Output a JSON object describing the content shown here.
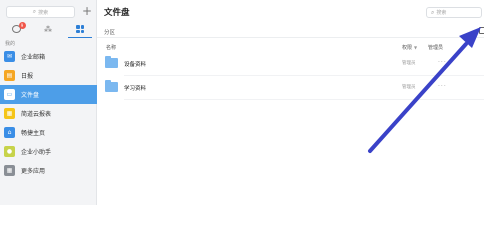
{
  "sidebar": {
    "search_placeholder": "搜索",
    "add_icon": "plus-icon",
    "tabs": [
      {
        "icon": "chat-icon",
        "badge": "9"
      },
      {
        "icon": "contacts-icon"
      },
      {
        "icon": "apps-grid-icon"
      }
    ],
    "section_label": "我的",
    "items": [
      {
        "label": "企业邮箱",
        "icon": "mail-icon",
        "color": "#3a8ee6"
      },
      {
        "label": "日报",
        "icon": "calendar-icon",
        "color": "#f5a623"
      },
      {
        "label": "文件盘",
        "icon": "folder-icon",
        "color": "#ffffff"
      },
      {
        "label": "简道云报表",
        "icon": "report-icon",
        "color": "#f5c518"
      },
      {
        "label": "畅捷主页",
        "icon": "home-icon",
        "color": "#3a8ee6"
      },
      {
        "label": "企业小助手",
        "icon": "assistant-icon",
        "color": "#c7d34a"
      },
      {
        "label": "更多应用",
        "icon": "more-apps-icon",
        "color": "#8a8f96"
      }
    ]
  },
  "main": {
    "title": "文件盘",
    "search_placeholder": "搜索",
    "partition_label": "分区",
    "columns": {
      "name": "名称",
      "permission": "权限",
      "manager": "管理员"
    },
    "rows": [
      {
        "name": "设备资料",
        "permission": "管理员",
        "more": "···"
      },
      {
        "name": "学习资料",
        "permission": "管理员",
        "more": "···"
      }
    ]
  },
  "colors": {
    "accent": "#4d9ee8",
    "arrow": "#3a42c8"
  }
}
